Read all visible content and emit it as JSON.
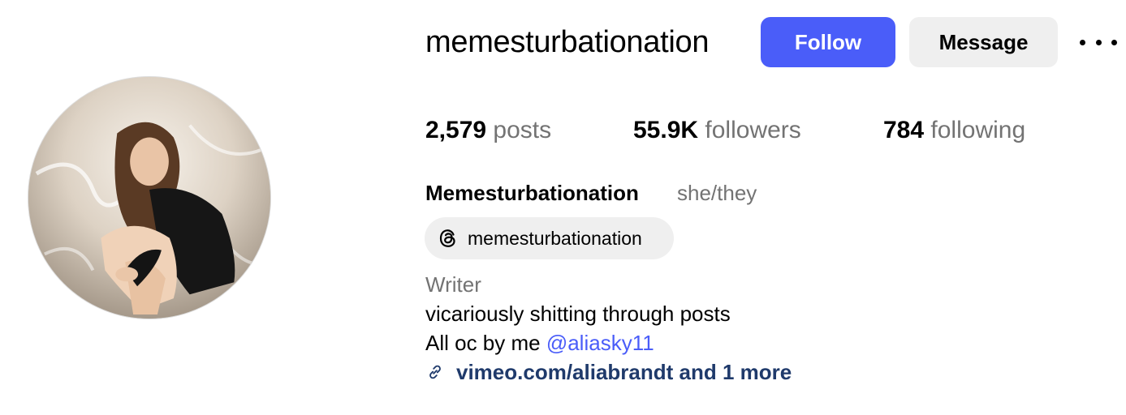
{
  "profile": {
    "username": "memesturbationation",
    "full_name": "Memesturbationation",
    "pronouns": "she/they",
    "category": "Writer",
    "avatar_alt": "profile-photo"
  },
  "actions": {
    "follow_label": "Follow",
    "message_label": "Message",
    "more_icon": "more-options-icon"
  },
  "stats": {
    "posts": {
      "value": "2,579",
      "label": "posts"
    },
    "followers": {
      "value": "55.9K",
      "label": "followers"
    },
    "following": {
      "value": "784",
      "label": "following"
    }
  },
  "threads": {
    "icon": "threads-icon",
    "handle": "memesturbationation"
  },
  "bio": {
    "line1": "vicariously shitting through posts",
    "line2_prefix": "All oc by me ",
    "line2_mention": "@aliasky11"
  },
  "link": {
    "icon": "link-icon",
    "text": "vimeo.com/aliabrandt and 1 more"
  },
  "colors": {
    "accent": "#4a5df9",
    "muted_text": "#737373",
    "button_gray": "#efefef",
    "link_text": "#1f3a6b"
  }
}
